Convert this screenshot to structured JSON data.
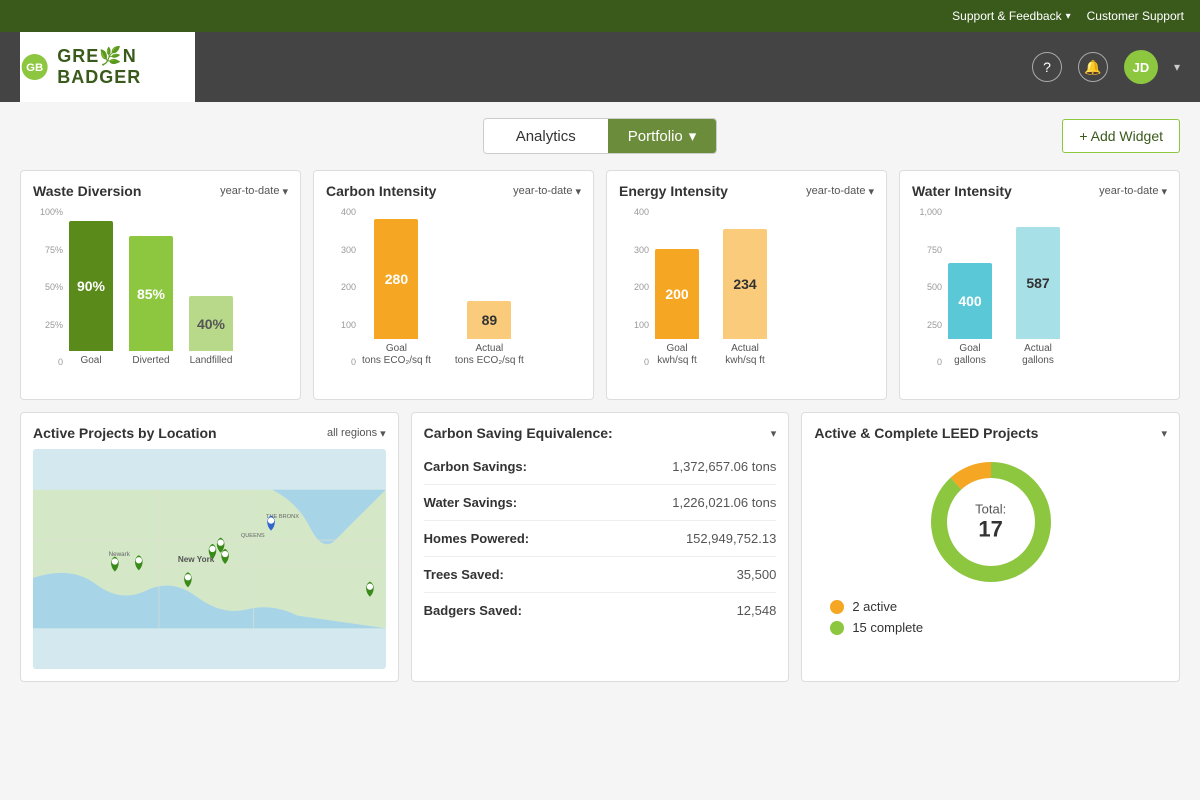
{
  "topbar": {
    "support_feedback": "Support & Feedback",
    "customer_support": "Customer Support"
  },
  "header": {
    "logo_text_1": "GRE",
    "logo_text_2": "N BADGER",
    "user_initials": "JD"
  },
  "toolbar": {
    "analytics_label": "Analytics",
    "portfolio_label": "Portfolio",
    "add_widget_label": "+ Add Widget"
  },
  "widgets": {
    "waste": {
      "title": "Waste Diversion",
      "filter": "year-to-date",
      "bars": [
        {
          "label": "Goal",
          "value": "90%",
          "height": 130,
          "color": "dark-green"
        },
        {
          "label": "Diverted",
          "value": "85%",
          "height": 115,
          "color": "mid-green"
        },
        {
          "label": "Landfilled",
          "value": "40%",
          "height": 55,
          "color": "light-green"
        }
      ],
      "y_labels": [
        "100%",
        "75%",
        "50%",
        "25%",
        "0"
      ]
    },
    "carbon": {
      "title": "Carbon Intensity",
      "filter": "year-to-date",
      "bars": [
        {
          "label": "Goal",
          "sublabel": "tons ECO₂/sq ft",
          "value": "280",
          "height": 120,
          "color": "dark-orange"
        },
        {
          "label": "Actual",
          "sublabel": "tons ECO₂/sq ft",
          "value": "89",
          "height": 38,
          "color": "light-orange"
        }
      ],
      "y_labels": [
        "400",
        "300",
        "200",
        "100",
        "0"
      ]
    },
    "energy": {
      "title": "Energy Intensity",
      "filter": "year-to-date",
      "bars": [
        {
          "label": "Goal",
          "sublabel": "kwh/sq ft",
          "value": "200",
          "height": 90,
          "color": "dark-orange"
        },
        {
          "label": "Actual",
          "sublabel": "kwh/sq ft",
          "value": "234",
          "height": 110,
          "color": "light-orange"
        }
      ],
      "y_labels": [
        "400",
        "300",
        "200",
        "100",
        "0"
      ]
    },
    "water": {
      "title": "Water Intensity",
      "filter": "year-to-date",
      "bars": [
        {
          "label": "Goal",
          "sublabel": "gallons",
          "value": "400",
          "height": 76,
          "color": "cyan"
        },
        {
          "label": "Actual",
          "sublabel": "gallons",
          "value": "587",
          "height": 112,
          "color": "light-cyan"
        }
      ],
      "y_labels": [
        "1,000",
        "750",
        "500",
        "250",
        "0"
      ]
    },
    "map": {
      "title": "Active Projects by Location",
      "filter": "all regions"
    },
    "savings": {
      "title": "Carbon Saving Equivalence:",
      "rows": [
        {
          "label": "Carbon Savings:",
          "value": "1,372,657.06 tons"
        },
        {
          "label": "Water Savings:",
          "value": "1,226,021.06 tons"
        },
        {
          "label": "Homes Powered:",
          "value": "152,949,752.13"
        },
        {
          "label": "Trees Saved:",
          "value": "35,500"
        },
        {
          "label": "Badgers Saved:",
          "value": "12,548"
        }
      ]
    },
    "leed": {
      "title": "Active & Complete LEED Projects",
      "total_label": "Total:",
      "total_value": "17",
      "active_count": "2 active",
      "complete_count": "15 complete",
      "active_color": "#f5a623",
      "complete_color": "#8dc63f"
    }
  }
}
